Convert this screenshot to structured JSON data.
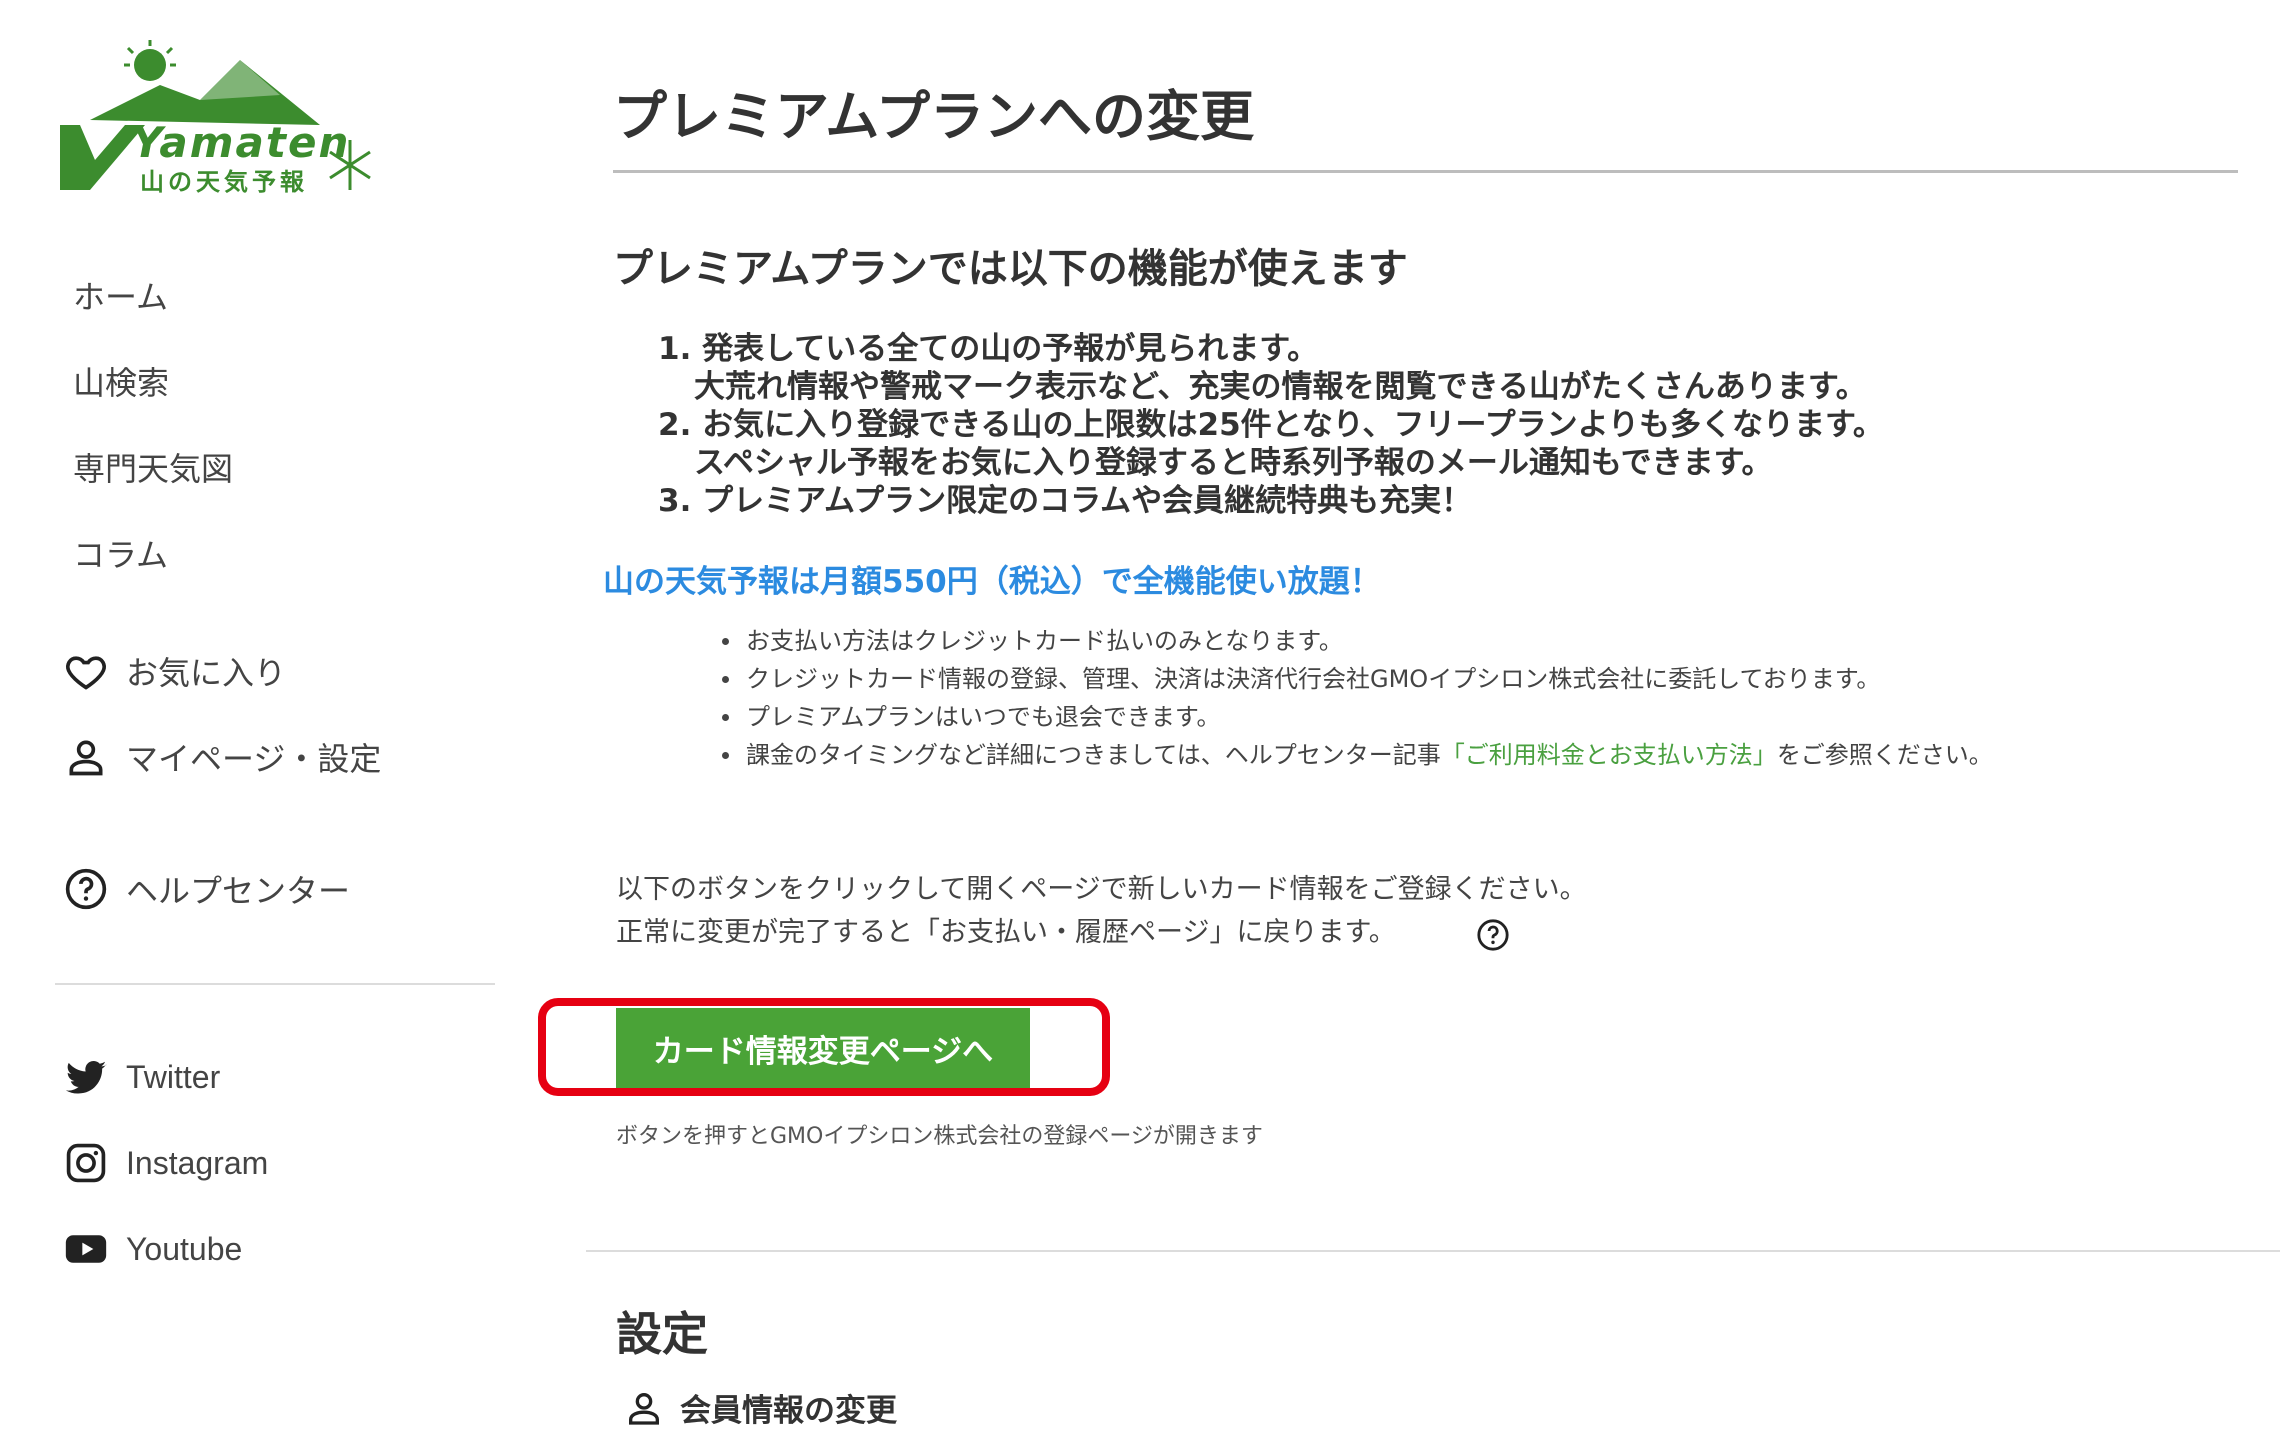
{
  "logo": {
    "brand": "Yamaten",
    "subtitle": "山の天気予報"
  },
  "sidebar": {
    "nav": [
      {
        "label": "ホーム"
      },
      {
        "label": "山検索"
      },
      {
        "label": "専門天気図"
      },
      {
        "label": "コラム"
      }
    ],
    "favorites": {
      "label": "お気に入り",
      "icon": "heart-icon"
    },
    "mypage": {
      "label": "マイページ・設定",
      "icon": "person-icon"
    },
    "help": {
      "label": "ヘルプセンター",
      "icon": "help-circle-icon"
    },
    "social": [
      {
        "label": "Twitter",
        "icon": "twitter-icon"
      },
      {
        "label": "Instagram",
        "icon": "instagram-icon"
      },
      {
        "label": "Youtube",
        "icon": "youtube-icon"
      }
    ]
  },
  "main": {
    "title": "プレミアムプランへの変更",
    "subtitle": "プレミアムプランでは以下の機能が使えます",
    "features": [
      "1. 発表している全ての山の予報が見られます。",
      "大荒れ情報や警戒マーク表示など、充実の情報を閲覧できる山がたくさんあります。",
      "2. お気に入り登録できる山の上限数は25件となり、フリープランよりも多くなります。",
      "スペシャル予報をお気に入り登録すると時系列予報のメール通知もできます。",
      "3. プレミアムプラン限定のコラムや会員継続特典も充実！"
    ],
    "price_text": "山の天気予報は月額550円（税込）で全機能使い放題！",
    "notes": [
      "お支払い方法はクレジットカード払いのみとなります。",
      "クレジットカード情報の登録、管理、決済は決済代行会社GMOイプシロン株式会社に委託しております。",
      "プレミアムプランはいつでも退会できます。"
    ],
    "note4": {
      "prefix": "課金のタイミングなど詳細につきましては、ヘルプセンター記事",
      "link": "「ご利用料金とお支払い方法」",
      "suffix": "をご参照ください。"
    },
    "instructions": [
      "以下のボタンをクリックして開くページで新しいカード情報をご登録ください。",
      "正常に変更が完了すると「お支払い・履歴ページ」に戻ります。"
    ],
    "card_button_label": "カード情報変更ページへ",
    "button_note": "ボタンを押すとGMOイプシロン株式会社の登録ページが開きます",
    "settings_title": "設定",
    "member_change_label": "会員情報の変更"
  },
  "colors": {
    "brand_green": "#3c8c2e",
    "button_green": "#4aa337",
    "link_green": "#4aa040",
    "price_blue": "#2c8be0",
    "highlight_red": "#e60012"
  }
}
